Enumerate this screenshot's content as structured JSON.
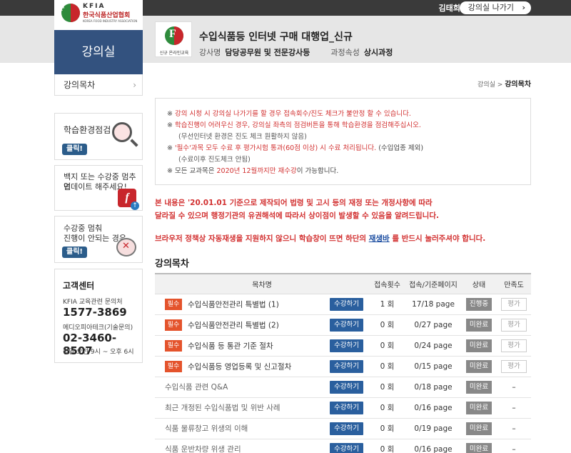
{
  "topbar": {
    "user": "김태희님",
    "exit": "강의실 나가기",
    "exit_chevron": "›"
  },
  "logo": {
    "letter": "F",
    "line1": "KFIA",
    "line2": "한국식품산업협회",
    "line3": "KOREA FOOD INDUSTRY ASSOCIATION"
  },
  "sidebar": {
    "title": "강의실",
    "toc_link": "강의목차",
    "toc_chevron": "›",
    "card1": {
      "text": "학습환경점검",
      "button": "클릭!"
    },
    "card2": {
      "text1": "백지 또는 수강중 멈추면",
      "text2": "업데이트 해주세요!",
      "icon_letter": "f",
      "icon_arrow": "↑"
    },
    "card3": {
      "text1": "수강중 멈춰",
      "text2": "진행이 안되는 경우",
      "button": "클릭!"
    },
    "cs": {
      "title": "고객센터",
      "label1": "KFIA 교육관련 문의처",
      "phone1": "1577-3869",
      "label2": "메디오피아테크(기술문의)",
      "phone2": "02-3460-8507",
      "hours": "평일 오전 9시 ~ 오후 6시"
    }
  },
  "course": {
    "logo_letter": "F",
    "logo_caption": "신규 온라인교육",
    "title": "수입식품등 인터넷 구매 대행업_신규",
    "lecturer_label": "강사명",
    "lecturer": "담당공무원 및 전문강사등",
    "attr_label": "과정속성",
    "attr": "상시과정"
  },
  "breadcrumb": {
    "home": "강의실",
    "sep": ">",
    "current": "강의목차"
  },
  "notice": {
    "mark": "※",
    "l1": "강의 시청 시 강의실 나가기를 할 경우 접속회수/진도 체크가 불안정 할 수 있습니다.",
    "l2": "학습진행이 어려우신 경우, 강의실 좌측의 점검버튼을 통해 학습환경을 점검해주십시오.",
    "l2b": "(무선인터넷 환경은 진도 체크 원활하지 않음)",
    "l3": "'필수'과목 모두 수료 후 평가시험 통과(60점 이상) 시 수료 처리됩니다.",
    "l3_tail": "(수입업종 제외)",
    "l3b": "(수료이후 진도체크 안됨)",
    "l4_pre": "모든 교과목은",
    "l4_red": "2020년 12월까지만 재수강",
    "l4_post": "이 가능합니다."
  },
  "warning1": {
    "line1": "본 내용은 '20.01.01 기준으로 제작되어 법령 및 고시 등의 재정 또는 개정사항에 따라",
    "line2": "달라질 수 있으며 행정기관의 유권해석에 따라서 상이점이 발생할 수 있음을 알려드립니다."
  },
  "warning2": {
    "pre": "브라우저 정책상 자동재생을 지원하지 않으니 학습창이 뜨면 하단의 ",
    "link": "재생바",
    "post": " 를 반드시 눌러주셔야 합니다."
  },
  "section_title": "강의목차",
  "table": {
    "headers": [
      "목차명",
      "",
      "접속횟수",
      "접속/기준페이지",
      "상태",
      "만족도"
    ],
    "take_label": "수강하기",
    "required_label": "필수",
    "rows": [
      {
        "name": "수입식품안전관리 특별법 (1)",
        "required": true,
        "count": "1 회",
        "pages": "17/18 page",
        "status": "진행중",
        "eval": "평가"
      },
      {
        "name": "수입식품안전관리 특별법 (2)",
        "required": true,
        "count": "0 회",
        "pages": "0/27 page",
        "status": "미완료",
        "eval": "평가"
      },
      {
        "name": "수입식품 등 통관 기준 절차",
        "required": true,
        "count": "0 회",
        "pages": "0/24 page",
        "status": "미완료",
        "eval": "평가"
      },
      {
        "name": "수입식품등 영업등록 및 신고절차",
        "required": true,
        "count": "0 회",
        "pages": "0/15 page",
        "status": "미완료",
        "eval": "평가"
      },
      {
        "name": "수입식품 관련 Q&A",
        "required": false,
        "count": "0 회",
        "pages": "0/18 page",
        "status": "미완료",
        "eval": "–"
      },
      {
        "name": "최근 개정된 수입식품법 및 위반 사례",
        "required": false,
        "count": "0 회",
        "pages": "0/16 page",
        "status": "미완료",
        "eval": "–"
      },
      {
        "name": "식품 물류창고 위생의 이해",
        "required": false,
        "count": "0 회",
        "pages": "0/19 page",
        "status": "미완료",
        "eval": "–"
      },
      {
        "name": "식품 운반차량 위생 관리",
        "required": false,
        "count": "0 회",
        "pages": "0/16 page",
        "status": "미완료",
        "eval": "–"
      }
    ]
  }
}
